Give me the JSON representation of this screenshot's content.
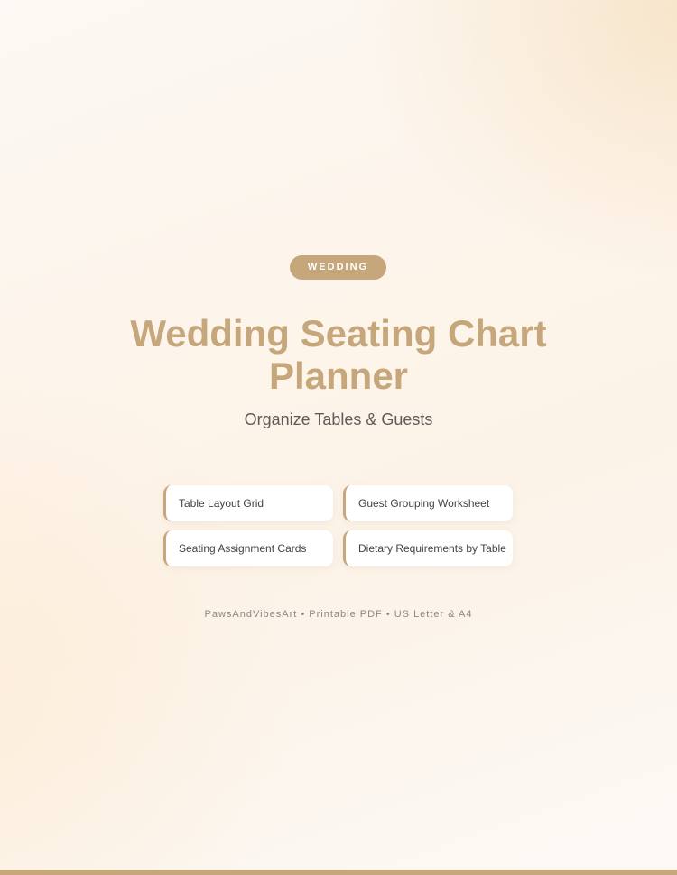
{
  "badge": "WEDDING",
  "title": {
    "line1": "Wedding Seating Chart",
    "line2": "Planner"
  },
  "subtitle": "Organize Tables & Guests",
  "features": [
    "Table Layout Grid",
    "Guest Grouping Worksheet",
    "Seating Assignment Cards",
    "Dietary Requirements by Table"
  ],
  "footer": "PawsAndVibesArt • Printable PDF • US Letter & A4",
  "colors": {
    "accent": "#c6a67b",
    "text": "#45423f",
    "muted": "#8c8884"
  }
}
